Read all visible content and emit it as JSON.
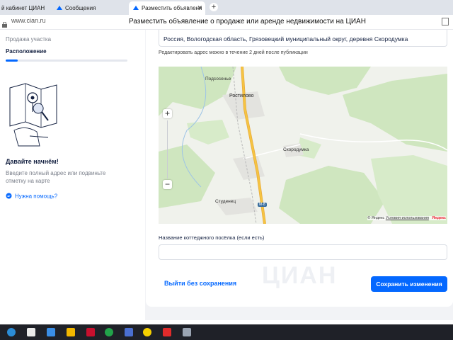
{
  "browser": {
    "tabs": [
      {
        "label": "й кабинет ЦИАН"
      },
      {
        "label": "Сообщения"
      },
      {
        "label": "Разместить объявлени"
      }
    ],
    "url": "www.cian.ru",
    "page_title": "Разместить объявление о продаже или аренде недвижимости на ЦИАН"
  },
  "sidebar": {
    "step_prev": "Продажа участка",
    "step_current": "Расположение",
    "progress": 0.1,
    "start_title": "Давайте начнём!",
    "start_desc": "Введите полный адрес или подвиньте отметку на карте",
    "help_link": "Нужна помощь?"
  },
  "form": {
    "address_value": "Россия, Вологодская область, Грязовецкий муниципальный округ, деревня Скородумка",
    "address_note": "Редактировать адрес можно в течение 2 дней после публикации",
    "village_label": "Название коттеджного посёлка (если есть)",
    "village_value": "",
    "exit_button": "Выйти без сохранения",
    "save_button": "Сохранить изменения",
    "watermark": "ЦИАН"
  },
  "map": {
    "labels": {
      "podsosenye": "Подсосенье",
      "rostilovo": "Ростилово",
      "skorodumka": "Скородумка",
      "studenets": "Студенец",
      "road": "М-8"
    },
    "attribution": "© Яндекс",
    "terms": "Условия использования",
    "logo": "Яндекс",
    "zoom_in": "+",
    "zoom_out": "−"
  },
  "colors": {
    "accent": "#0468ff",
    "text": "#152242",
    "forest": "#c9e3b4",
    "road": "#f5c542"
  }
}
